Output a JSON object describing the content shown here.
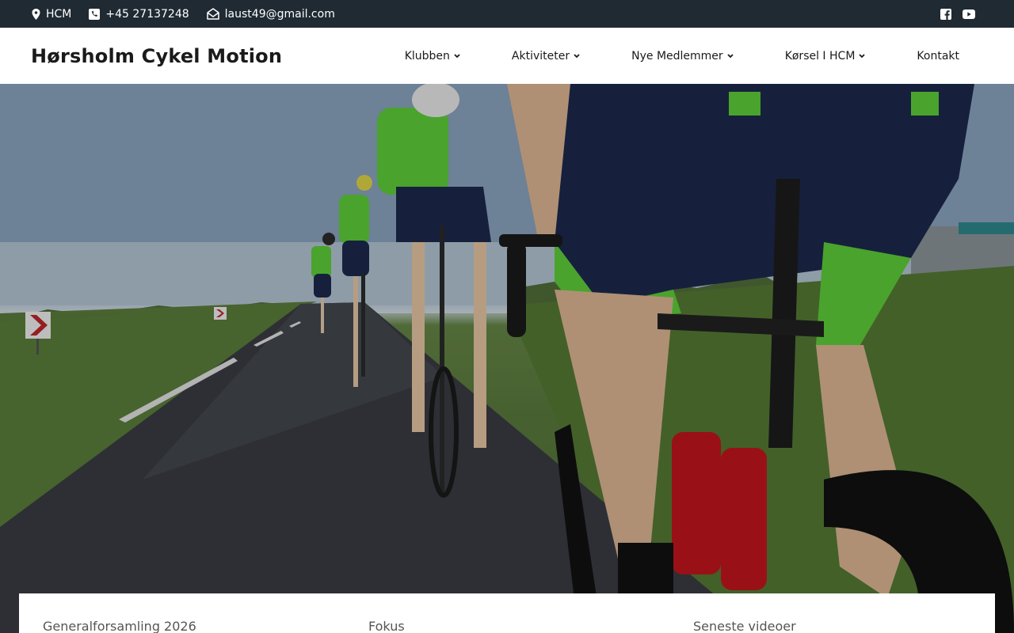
{
  "topbar": {
    "location": "HCM",
    "phone": "+45 27137248",
    "email": "laust49@gmail.com",
    "location_icon": "map-pin-icon",
    "phone_icon": "phone-icon",
    "email_icon": "envelope-open-icon",
    "social": [
      {
        "icon": "facebook-icon"
      },
      {
        "icon": "youtube-icon"
      }
    ]
  },
  "header": {
    "brand": "Hørsholm Cykel Motion",
    "nav": [
      {
        "label": "Klubben",
        "has_dropdown": true
      },
      {
        "label": "Aktiviteter",
        "has_dropdown": true
      },
      {
        "label": "Nye Medlemmer",
        "has_dropdown": true
      },
      {
        "label": "Kørsel I HCM",
        "has_dropdown": true
      },
      {
        "label": "Kontakt",
        "has_dropdown": false
      }
    ]
  },
  "hero": {
    "image_subject": "group of cyclists in green jerseys riding on a country road"
  },
  "panel": {
    "columns": [
      {
        "title": "Generalforsamling 2026"
      },
      {
        "title": "Fokus"
      },
      {
        "title": "Seneste videoer"
      }
    ]
  },
  "colors": {
    "topbar_bg": "#1f2a33",
    "header_bg": "#ffffff",
    "jersey_green": "#5fd13a",
    "shorts_navy": "#1d2a4e"
  }
}
